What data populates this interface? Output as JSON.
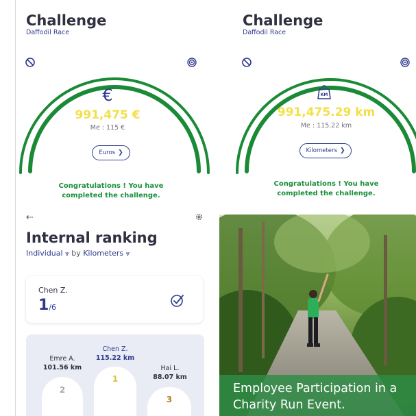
{
  "challenges": [
    {
      "title": "Challenge",
      "subtitle": "Daffodil Race",
      "unit_icon": "euro-icon",
      "unit_glyph": "€",
      "total": "991,475 €",
      "me": "Me : 115 €",
      "button_label": "Euros",
      "congrats": "Congratulations ! You have completed the challenge.",
      "progress": 1.0
    },
    {
      "title": "Challenge",
      "subtitle": "Daffodil Race",
      "unit_icon": "km-weight-icon",
      "unit_glyph": "KM",
      "total": "991,475.29 km",
      "me": "Me : 115.22 km",
      "button_label": "Kilometers",
      "congrats": "Congratulations ! You have completed the challenge.",
      "progress": 1.0
    }
  ],
  "ranking": {
    "title": "Internal ranking",
    "filter_scope": "Individual",
    "filter_by": "by",
    "filter_metric": "Kilometers",
    "me_name": "Chen Z.",
    "me_rank": "1",
    "me_total": "/6",
    "podium": [
      {
        "place": "2",
        "name": "Emre A.",
        "km": "101.56 km",
        "color": "#aaaaaa"
      },
      {
        "place": "1",
        "name": "Chen Z.",
        "km": "115.22 km",
        "color": "#d9c23a"
      },
      {
        "place": "3",
        "name": "Hai L.",
        "km": "88.07 km",
        "color": "#b5822f"
      }
    ]
  },
  "photo": {
    "caption": "Employee Participation in a Charity Run Event."
  },
  "colors": {
    "gauge_green": "#1a8a36",
    "accent_blue": "#2e3a8c",
    "value_yellow": "#f2e04b"
  }
}
